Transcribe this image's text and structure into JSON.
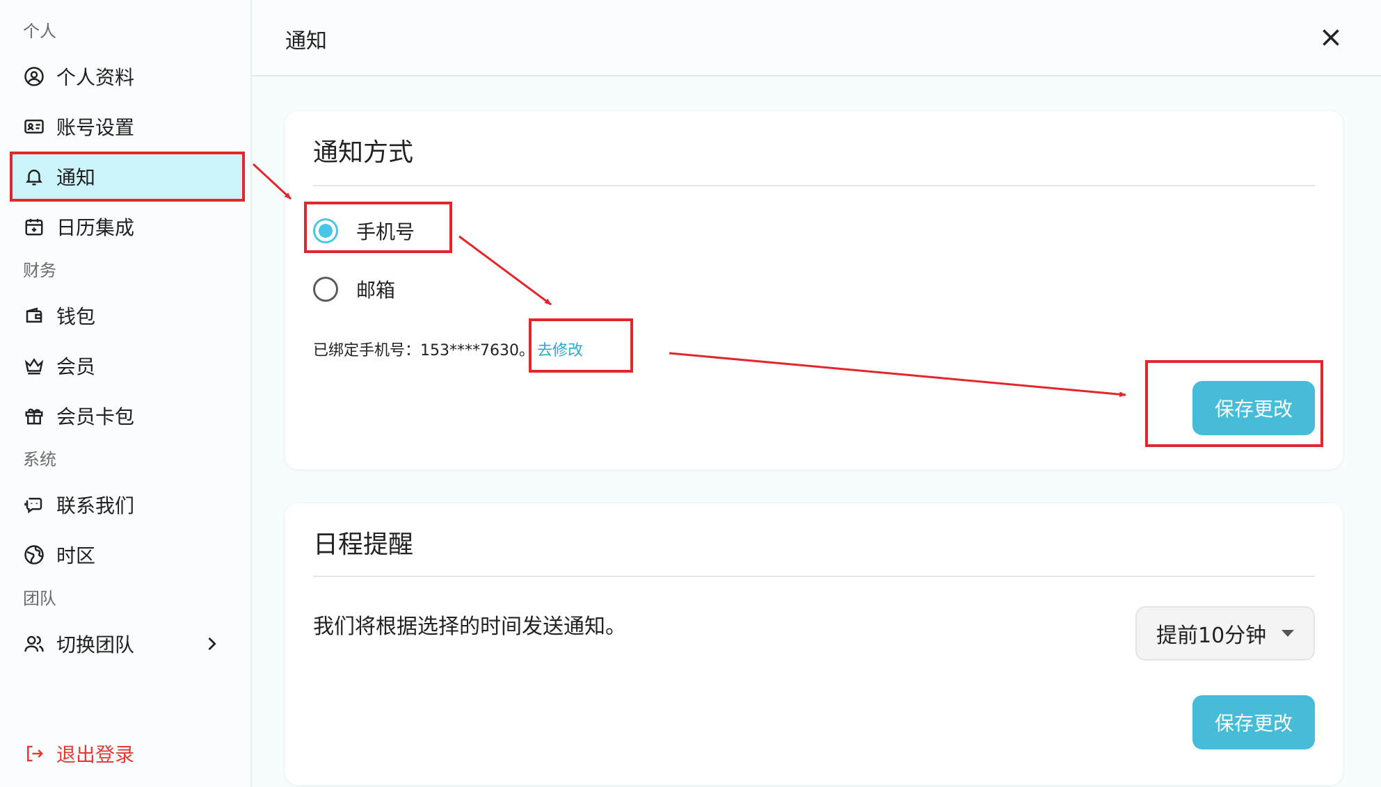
{
  "sidebar": {
    "sections": {
      "personal": "个人",
      "finance": "财务",
      "system": "系统",
      "team": "团队"
    },
    "items": {
      "profile": "个人资料",
      "account": "账号设置",
      "notifications": "通知",
      "calendar": "日历集成",
      "wallet": "钱包",
      "membership": "会员",
      "member_cards": "会员卡包",
      "contact": "联系我们",
      "timezone": "时区",
      "switch_team": "切换团队",
      "logout": "退出登录"
    },
    "active_item": "notifications"
  },
  "header": {
    "title": "通知"
  },
  "notify_card": {
    "title": "通知方式",
    "options": [
      {
        "label": "手机号",
        "checked": true
      },
      {
        "label": "邮箱",
        "checked": false
      }
    ],
    "bound_text": "已绑定手机号：153****7630。",
    "modify_link": "去修改",
    "save_label": "保存更改"
  },
  "reminder_card": {
    "title": "日程提醒",
    "description": "我们将根据选择的时间发送通知。",
    "select_value": "提前10分钟",
    "save_label": "保存更改"
  },
  "colors": {
    "accent": "#46bcd8",
    "active_bg": "#cbf4fb",
    "danger": "#e53935",
    "annotation": "#e3262c"
  }
}
